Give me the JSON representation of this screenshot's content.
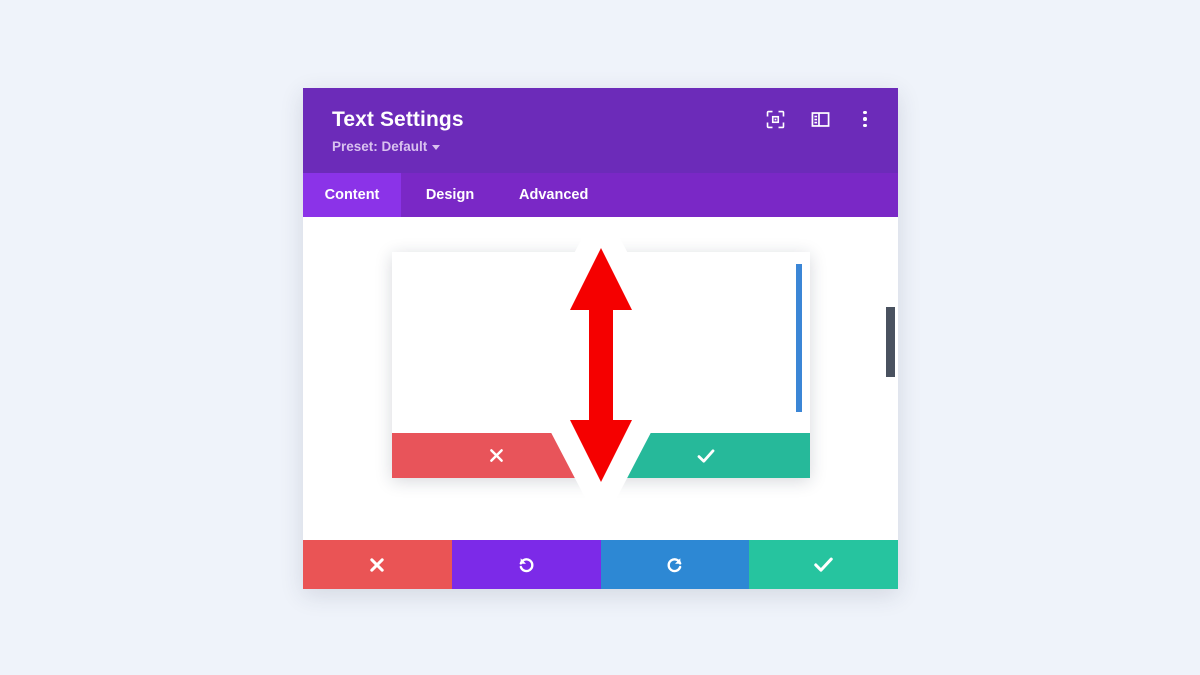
{
  "window": {
    "title": "Text Settings",
    "preset_label": "Preset: Default",
    "preset_caret_icon": "chevron-down-icon"
  },
  "header_icons": [
    {
      "name": "focus-target-icon",
      "label": ""
    },
    {
      "name": "layout-panel-icon",
      "label": ""
    },
    {
      "name": "more-vertical-icon",
      "label": ""
    }
  ],
  "tabs": [
    {
      "label": "Content",
      "active": true
    },
    {
      "label": "Design",
      "active": false
    },
    {
      "label": "Advanced",
      "active": false
    }
  ],
  "popup": {
    "cancel_icon": "close-x-icon",
    "confirm_icon": "check-icon",
    "scrollbar_color": "#3b86d6"
  },
  "scrollbar": {
    "thumb_color": "#49515f"
  },
  "cursor": {
    "type": "vertical-resize-arrow",
    "color": "#f50000",
    "outline": "#ffffff"
  },
  "actions": [
    {
      "name": "cancel-button",
      "icon": "close-x-icon",
      "color": "#ea5455"
    },
    {
      "name": "undo-button",
      "icon": "undo-icon",
      "color": "#7c2ae8"
    },
    {
      "name": "redo-button",
      "icon": "redo-icon",
      "color": "#2d88d4"
    },
    {
      "name": "save-button",
      "icon": "check-icon",
      "color": "#26c49f"
    }
  ],
  "theme": {
    "background": "#eff3fa",
    "header_purple": "#6c2bb9",
    "tabbar_purple": "#7a28c6",
    "active_tab_purple": "#8b33e8"
  }
}
